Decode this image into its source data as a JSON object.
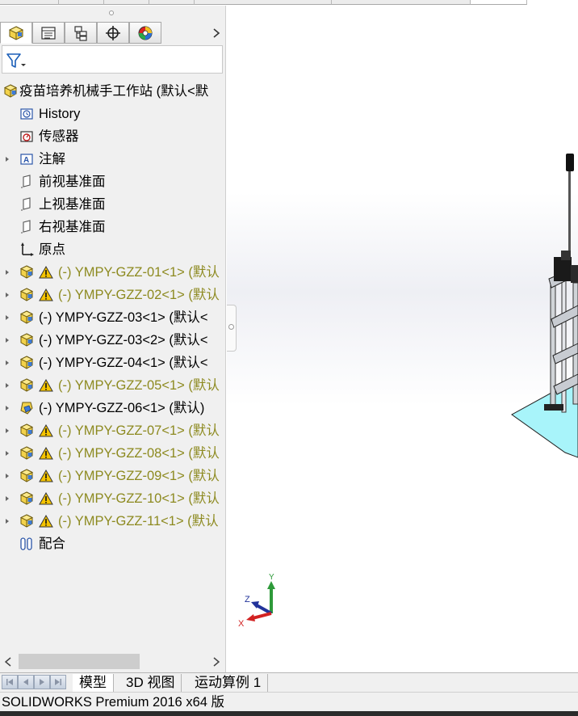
{
  "feature_manager": {
    "tabs": [
      {
        "icon": "feature-manager-icon",
        "active": true
      },
      {
        "icon": "property-manager-icon",
        "active": false
      },
      {
        "icon": "configuration-manager-icon",
        "active": false
      },
      {
        "icon": "dimxpert-icon",
        "active": false
      },
      {
        "icon": "display-manager-icon",
        "active": false
      }
    ],
    "filter_icon": "filter-icon",
    "root_label": "疫苗培养机械手工作站 (默认<默",
    "items": [
      {
        "label": "History",
        "icon": "history-icon",
        "expandable": false,
        "warning": false
      },
      {
        "label": "传感器",
        "icon": "sensor-icon",
        "expandable": false,
        "warning": false
      },
      {
        "label": "注解",
        "icon": "annotation-icon",
        "expandable": true,
        "warning": false
      },
      {
        "label": "前视基准面",
        "icon": "plane-icon",
        "expandable": false,
        "warning": false
      },
      {
        "label": "上视基准面",
        "icon": "plane-icon",
        "expandable": false,
        "warning": false
      },
      {
        "label": "右视基准面",
        "icon": "plane-icon",
        "expandable": false,
        "warning": false
      },
      {
        "label": "原点",
        "icon": "origin-icon",
        "expandable": false,
        "warning": false
      },
      {
        "label": "(-) YMPY-GZZ-01<1> (默认",
        "icon": "assembly-icon",
        "expandable": true,
        "warning": true
      },
      {
        "label": "(-) YMPY-GZZ-02<1> (默认",
        "icon": "assembly-icon",
        "expandable": true,
        "warning": true
      },
      {
        "label": "(-) YMPY-GZZ-03<1> (默认<",
        "icon": "assembly-icon",
        "expandable": true,
        "warning": false
      },
      {
        "label": "(-) YMPY-GZZ-03<2> (默认<",
        "icon": "assembly-icon",
        "expandable": true,
        "warning": false
      },
      {
        "label": "(-) YMPY-GZZ-04<1> (默认<",
        "icon": "assembly-icon",
        "expandable": true,
        "warning": false
      },
      {
        "label": "(-) YMPY-GZZ-05<1> (默认",
        "icon": "assembly-icon",
        "expandable": true,
        "warning": true
      },
      {
        "label": "(-) YMPY-GZZ-06<1> (默认)",
        "icon": "part-icon",
        "expandable": true,
        "warning": false
      },
      {
        "label": "(-) YMPY-GZZ-07<1> (默认",
        "icon": "assembly-icon",
        "expandable": true,
        "warning": true
      },
      {
        "label": "(-) YMPY-GZZ-08<1> (默认",
        "icon": "assembly-icon",
        "expandable": true,
        "warning": true
      },
      {
        "label": "(-) YMPY-GZZ-09<1> (默认",
        "icon": "assembly-icon",
        "expandable": true,
        "warning": true
      },
      {
        "label": "(-) YMPY-GZZ-10<1> (默认",
        "icon": "assembly-icon",
        "expandable": true,
        "warning": true
      },
      {
        "label": "(-) YMPY-GZZ-11<1> (默认",
        "icon": "assembly-icon",
        "expandable": true,
        "warning": true
      },
      {
        "label": "配合",
        "icon": "mates-icon",
        "expandable": false,
        "warning": false
      }
    ]
  },
  "triad": {
    "x_label": "X",
    "y_label": "Y",
    "z_label": "Z"
  },
  "bottom_tabs": [
    {
      "label": "模型",
      "active": true
    },
    {
      "label": "3D 视图",
      "active": false
    },
    {
      "label": "运动算例 1",
      "active": false
    }
  ],
  "status_bar": {
    "text": "SOLIDWORKS Premium 2016 x64 版"
  },
  "colors": {
    "warning_text": "#8d8a20",
    "selection_line": "#2f5fbf",
    "base_plate": "#a8f4fa"
  }
}
